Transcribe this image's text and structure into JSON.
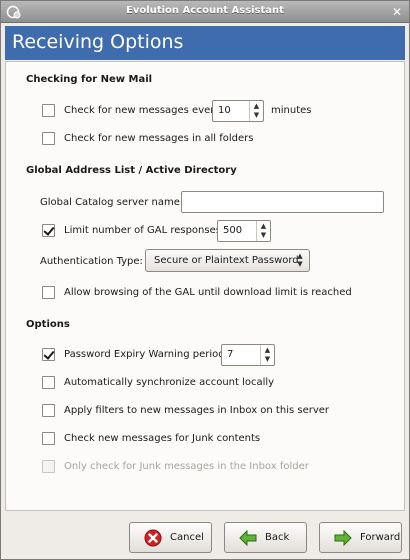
{
  "window": {
    "title": "Evolution Account Assistant"
  },
  "header": {
    "title": "Receiving Options"
  },
  "checking": {
    "heading": "Checking for New Mail",
    "check_every_label": "Check for new messages every",
    "interval_value": "10",
    "interval_unit": "minutes",
    "check_all_folders_label": "Check for new messages in all folders"
  },
  "gal": {
    "heading": "Global Address List / Active Directory",
    "server_label": "Global Catalog server name:",
    "server_value": "",
    "limit_label": "Limit number of GAL responses:",
    "limit_value": "500",
    "auth_label": "Authentication Type:",
    "auth_value": "Secure or Plaintext Password",
    "allow_browsing_label": "Allow browsing of the GAL until download limit is reached"
  },
  "options": {
    "heading": "Options",
    "password_expiry_label": "Password Expiry Warning period:",
    "password_expiry_value": "7",
    "auto_sync_label": "Automatically synchronize account locally",
    "apply_filters_label": "Apply filters to new messages in Inbox on this server",
    "check_junk_label": "Check new messages for Junk contents",
    "junk_inbox_only_label": "Only check for Junk messages in the Inbox folder"
  },
  "buttons": {
    "cancel": "Cancel",
    "back": "Back",
    "forward": "Forward"
  },
  "colors": {
    "header_bg": "#3f6cac",
    "panel_bg": "#fcfbfa",
    "window_bg": "#efebe7"
  },
  "icons": {
    "app": "evolution-app-icon",
    "close": "close-icon",
    "cancel": "cancel-icon",
    "back": "back-arrow-icon",
    "forward": "forward-arrow-icon"
  }
}
